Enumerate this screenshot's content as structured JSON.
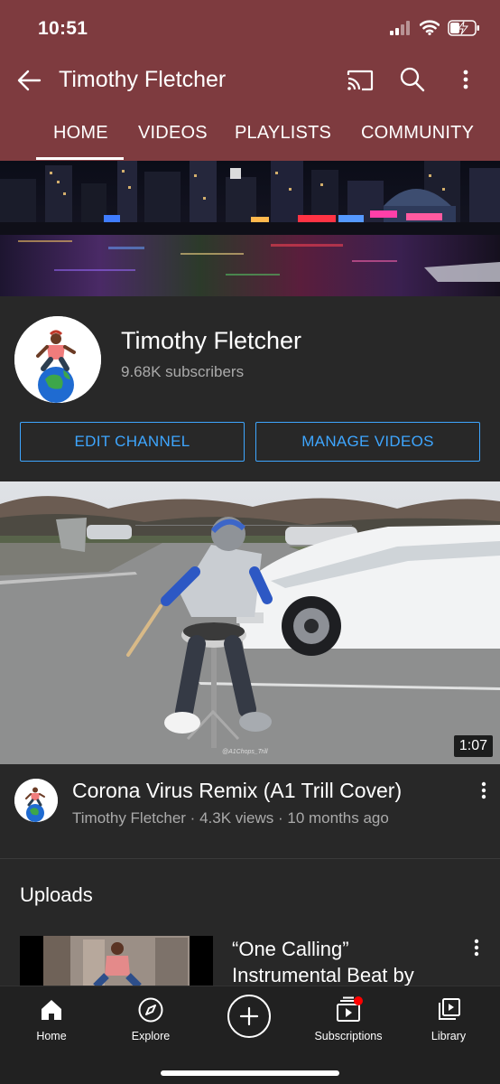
{
  "status_bar": {
    "time": "10:51"
  },
  "app_bar": {
    "title": "Timothy Fletcher",
    "icons": [
      "back-arrow-icon",
      "cast-icon",
      "search-icon",
      "more-vert-icon"
    ]
  },
  "tabs": [
    {
      "label": "HOME",
      "selected": true
    },
    {
      "label": "VIDEOS",
      "selected": false
    },
    {
      "label": "PLAYLISTS",
      "selected": false
    },
    {
      "label": "COMMUNITY",
      "selected": false
    }
  ],
  "channel": {
    "name": "Timothy Fletcher",
    "subscribers": "9.68K subscribers",
    "edit_button": "EDIT CHANNEL",
    "manage_button": "MANAGE VIDEOS"
  },
  "featured_video": {
    "duration": "1:07",
    "watermark": "@A1Chops_Trill",
    "title": "Corona Virus Remix (A1 Trill Cover)",
    "meta": "Timothy Fletcher · 4.3K views · 10 months ago"
  },
  "uploads": {
    "heading": "Uploads",
    "items": [
      {
        "title": "“One Calling” Instrumental Beat by"
      }
    ]
  },
  "bottom_nav": [
    {
      "label": "Home",
      "icon": "home-icon",
      "selected": true
    },
    {
      "label": "Explore",
      "icon": "compass-icon"
    },
    {
      "label": "",
      "icon": "create-plus-icon"
    },
    {
      "label": "Subscriptions",
      "icon": "subscriptions-icon",
      "badge": true
    },
    {
      "label": "Library",
      "icon": "library-icon"
    }
  ],
  "colors": {
    "header_bg": "#7e3b3f",
    "page_bg": "#282828",
    "accent_blue": "#3ea6ff",
    "secondary_text": "#aaaaaa",
    "notification_red": "#ff0000"
  }
}
